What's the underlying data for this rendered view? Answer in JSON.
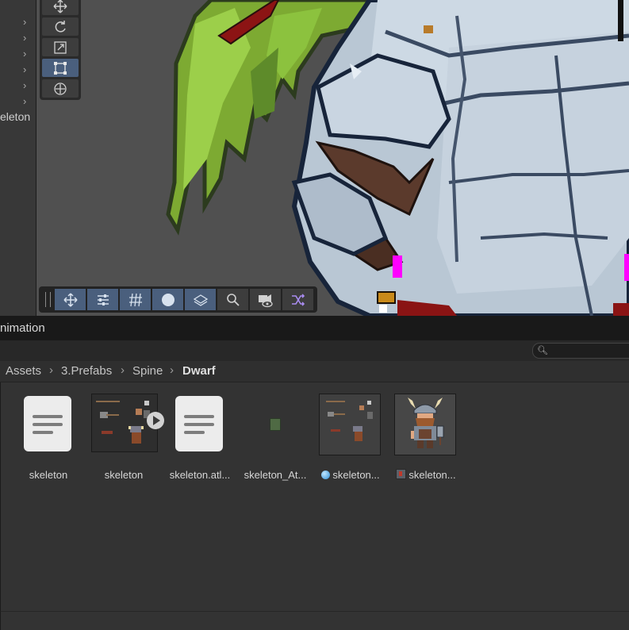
{
  "hierarchy": {
    "partial_label": "eleton"
  },
  "scene_tools": {
    "vertical": [
      "move-tool",
      "rotate-tool",
      "scale-tool",
      "rect-tool",
      "transform-tool"
    ],
    "active": "rect-tool",
    "overlay": [
      "move-overlay",
      "settings-overlay",
      "grid-overlay",
      "circle-overlay",
      "layers-overlay",
      "search-overlay",
      "camera-overlay",
      "shuffle-overlay"
    ]
  },
  "panel": {
    "tab_label": "nimation"
  },
  "breadcrumb": {
    "root": "Assets",
    "part1": "3.Prefabs",
    "part2": "Spine",
    "current": "Dwarf"
  },
  "assets": {
    "item1": {
      "label": "skeleton",
      "icon": "text-document-icon"
    },
    "item2": {
      "label": "skeleton",
      "icon": "skeleton-data-icon"
    },
    "item3": {
      "label": "skeleton.atl...",
      "icon": "text-document-icon"
    },
    "item4": {
      "label": "skeleton_At...",
      "icon": "texture-icon"
    },
    "item5": {
      "label": "skeleton...",
      "icon": "atlas-material-icon"
    },
    "item6": {
      "label": "skeleton...",
      "icon": "dwarf-prefab-icon"
    }
  },
  "colors": {
    "accent": "#4a5f7d",
    "play": "#d2d2d2",
    "highlight": "#ff00ff"
  }
}
